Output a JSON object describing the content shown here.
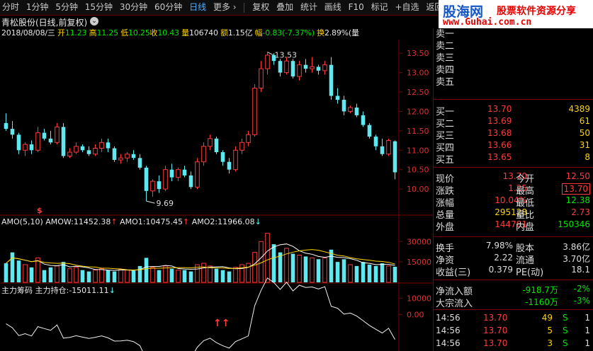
{
  "toolbar": {
    "items": [
      "分时",
      "1分钟",
      "5分钟",
      "15分钟",
      "30分钟",
      "60分钟",
      "日线",
      "更多",
      "复权",
      "叠加",
      "统计",
      "画线",
      "F10",
      "标记",
      "+自选",
      "返回"
    ]
  },
  "brand": {
    "name": "股海网",
    "slogan": "股票软件资源分享",
    "url": "www.Guhai.com.cn"
  },
  "chart_header": {
    "title": "青松股份(日线,前复权)",
    "quote_line": {
      "date": "2018/08/08/三",
      "open_label": "开",
      "open": "11.23",
      "high_label": "高",
      "high": "11.25",
      "low_label": "低",
      "low": "10.25",
      "close_label": "收",
      "close": "10.43",
      "vol_label": "量",
      "vol": "106740",
      "amt_label": "额",
      "amt": "1.15亿",
      "chg_label": "幅",
      "chg": "-0.83(-7.37%)",
      "turnover_label": "换",
      "turnover": "2.89%",
      "trail": "(量"
    },
    "max_label": "13.53",
    "min_label": "9.69"
  },
  "chart_data": [
    {
      "type": "candlestick",
      "title": "青松股份(日线,前复权)",
      "ylim": [
        9.4,
        13.85
      ],
      "ticks": [
        "13.50",
        "13.00",
        "12.50",
        "12.00",
        "11.50",
        "11.00",
        "10.50",
        "10.00"
      ],
      "tick_values": [
        13.5,
        13.0,
        12.5,
        12.0,
        11.5,
        11.0,
        10.5,
        10.0
      ],
      "ohlc": [
        [
          11.7,
          11.95,
          11.5,
          11.55
        ],
        [
          11.55,
          11.75,
          11.3,
          11.4
        ],
        [
          11.4,
          11.45,
          10.9,
          11.0
        ],
        [
          11.0,
          11.2,
          10.85,
          11.15
        ],
        [
          11.15,
          11.25,
          10.9,
          11.0
        ],
        [
          11.0,
          11.6,
          10.95,
          11.45
        ],
        [
          11.45,
          11.55,
          11.25,
          11.3
        ],
        [
          11.3,
          11.5,
          11.15,
          11.2
        ],
        [
          11.2,
          11.7,
          11.15,
          11.6
        ],
        [
          11.6,
          11.7,
          10.8,
          10.85
        ],
        [
          10.85,
          11.05,
          10.8,
          10.95
        ],
        [
          10.95,
          11.2,
          10.9,
          11.1
        ],
        [
          11.1,
          11.15,
          10.95,
          11.0
        ],
        [
          11.0,
          11.1,
          10.85,
          10.9
        ],
        [
          10.9,
          11.15,
          10.85,
          11.05
        ],
        [
          11.05,
          11.3,
          10.95,
          11.2
        ],
        [
          11.2,
          11.3,
          10.95,
          11.05
        ],
        [
          11.05,
          11.1,
          10.7,
          10.75
        ],
        [
          10.75,
          10.9,
          10.65,
          10.8
        ],
        [
          10.8,
          10.95,
          10.7,
          10.9
        ],
        [
          10.9,
          11.0,
          10.75,
          10.8
        ],
        [
          10.8,
          10.9,
          10.5,
          10.55
        ],
        [
          10.55,
          10.6,
          9.69,
          9.95
        ],
        [
          9.95,
          10.25,
          9.8,
          10.2
        ],
        [
          10.2,
          10.35,
          9.9,
          10.0
        ],
        [
          10.0,
          10.6,
          9.95,
          10.5
        ],
        [
          10.5,
          10.65,
          10.2,
          10.3
        ],
        [
          10.3,
          10.55,
          10.2,
          10.5
        ],
        [
          10.5,
          10.6,
          10.3,
          10.35
        ],
        [
          10.35,
          10.45,
          10.0,
          10.05
        ],
        [
          10.05,
          10.8,
          10.0,
          10.7
        ],
        [
          10.7,
          11.2,
          10.6,
          11.1
        ],
        [
          11.1,
          11.4,
          11.0,
          11.3
        ],
        [
          11.3,
          11.35,
          10.9,
          10.95
        ],
        [
          10.95,
          11.0,
          10.6,
          10.7
        ],
        [
          10.7,
          10.8,
          10.4,
          10.5
        ],
        [
          10.5,
          11.1,
          10.45,
          11.0
        ],
        [
          11.0,
          11.3,
          10.9,
          11.2
        ],
        [
          11.2,
          11.5,
          11.1,
          11.4
        ],
        [
          11.4,
          12.7,
          11.35,
          12.6
        ],
        [
          12.6,
          13.3,
          12.5,
          13.1
        ],
        [
          13.1,
          13.53,
          12.95,
          13.45
        ],
        [
          13.45,
          13.5,
          13.2,
          13.3
        ],
        [
          13.3,
          13.35,
          12.9,
          13.0
        ],
        [
          13.0,
          13.4,
          12.95,
          13.3
        ],
        [
          13.3,
          13.35,
          12.85,
          12.9
        ],
        [
          12.9,
          13.3,
          12.8,
          13.2
        ],
        [
          13.2,
          13.35,
          13.0,
          13.1
        ],
        [
          13.1,
          13.4,
          13.0,
          13.15
        ],
        [
          13.15,
          13.2,
          12.95,
          13.05
        ],
        [
          13.05,
          13.3,
          12.95,
          13.2
        ],
        [
          13.2,
          13.4,
          12.3,
          12.4
        ],
        [
          12.4,
          12.6,
          12.2,
          12.3
        ],
        [
          12.3,
          12.4,
          11.9,
          12.0
        ],
        [
          12.0,
          12.15,
          11.95,
          12.1
        ],
        [
          12.1,
          12.2,
          11.85,
          11.9
        ],
        [
          11.9,
          12.0,
          11.6,
          11.65
        ],
        [
          11.65,
          11.7,
          11.3,
          11.35
        ],
        [
          11.35,
          11.4,
          11.0,
          11.1
        ],
        [
          11.1,
          11.3,
          10.85,
          10.9
        ],
        [
          10.9,
          11.3,
          10.85,
          11.25
        ],
        [
          11.23,
          11.25,
          10.25,
          10.43
        ]
      ]
    },
    {
      "type": "bar",
      "title": "AMO(5,10)",
      "series": [
        {
          "name": "AMOW",
          "last": "11452.38"
        },
        {
          "name": "AMO1",
          "last": "10475.45"
        },
        {
          "name": "AMO2",
          "last": "11966.08"
        }
      ],
      "ylim": [
        0,
        40000
      ],
      "ticks": [
        "30000",
        "15000"
      ],
      "tick_values": [
        30000,
        15000
      ],
      "values": [
        14000,
        22000,
        16000,
        13000,
        11000,
        18000,
        9000,
        11000,
        12000,
        15000,
        10000,
        11000,
        9000,
        8000,
        9000,
        10000,
        9000,
        8000,
        9500,
        9000,
        8500,
        12000,
        18000,
        11000,
        9000,
        12000,
        10000,
        9000,
        9000,
        8000,
        13000,
        14000,
        12000,
        10000,
        9000,
        8000,
        11000,
        13000,
        14000,
        22000,
        30000,
        36000,
        28000,
        22000,
        25000,
        21000,
        20000,
        19000,
        18000,
        17000,
        18000,
        24000,
        15000,
        17000,
        13000,
        12000,
        15000,
        13000,
        12000,
        14000,
        12000,
        11452
      ]
    },
    {
      "type": "line",
      "title": "主力筹码",
      "series": [
        {
          "name": "主力持仓",
          "last": "-15011.11"
        }
      ],
      "ylim": [
        -22000,
        14000
      ],
      "ticks": [
        "10000",
        "0.00"
      ],
      "tick_values": [
        10000,
        0
      ]
    }
  ],
  "amo_header": {
    "name": "AMO(5,10)",
    "amow_label": "AMOW:",
    "amow": "11452.38",
    "amo1_label": "AMO1:",
    "amo1": "10475.45",
    "amo2_label": "AMO2:",
    "amo2": "11966.08"
  },
  "zl_header": {
    "name": "主力筹码",
    "hold_label": "主力持仓:",
    "hold": "-15011.11"
  },
  "orderbook": {
    "asks": [
      {
        "label": "卖五"
      },
      {
        "label": "卖四"
      },
      {
        "label": "卖三"
      },
      {
        "label": "卖二"
      },
      {
        "label": "卖一"
      }
    ],
    "bids": [
      {
        "label": "买一",
        "price": "13.70",
        "vol": "4389"
      },
      {
        "label": "买二",
        "price": "13.69",
        "vol": "61"
      },
      {
        "label": "买三",
        "price": "13.68",
        "vol": "50"
      },
      {
        "label": "买四",
        "price": "13.66",
        "vol": "31"
      },
      {
        "label": "买五",
        "price": "13.65",
        "vol": "8"
      }
    ]
  },
  "quote": [
    {
      "l1": "现价",
      "v1": "13.70",
      "l2": "今开",
      "v2": "12.50"
    },
    {
      "l1": "涨跌",
      "v1": "1.25",
      "l2": "最高",
      "v2": "13.70"
    },
    {
      "l1": "涨幅",
      "v1": "10.04%",
      "l2": "最低",
      "v2": "12.38"
    },
    {
      "l1": "总量",
      "v1": "295128",
      "l2": "量比",
      "v2": "2.73"
    },
    {
      "l1": "外盘",
      "v1": "144781",
      "l2": "内盘",
      "v2": "150346"
    }
  ],
  "stats": [
    {
      "l1": "换手",
      "v1": "7.98%",
      "l2": "股本",
      "v2": "3.86亿"
    },
    {
      "l1": "净资",
      "v1": "2.22",
      "l2": "流通",
      "v2": "3.70亿"
    },
    {
      "l1": "收益(三)",
      "v1": "0.379",
      "l2": "PE(动)",
      "v2": "18.1"
    }
  ],
  "flows": [
    {
      "label": "净流入额",
      "value": "-918.7万",
      "pct": "-2%"
    },
    {
      "label": "大宗流入",
      "value": "-1160万",
      "pct": "-3%"
    }
  ],
  "ticks_list": [
    {
      "time": "14:56",
      "price": "13.70",
      "vol": "49",
      "side": "S",
      "n": "1"
    },
    {
      "time": "14:56",
      "price": "13.70",
      "vol": "5",
      "side": "S",
      "n": "1"
    },
    {
      "time": "14:56",
      "price": "13.70",
      "vol": "3",
      "side": "S",
      "n": "1"
    }
  ],
  "colors": {
    "up": "#ff3b3b",
    "down": "#5fe8f0",
    "bg": "#000000",
    "grid": "#7a0000"
  }
}
